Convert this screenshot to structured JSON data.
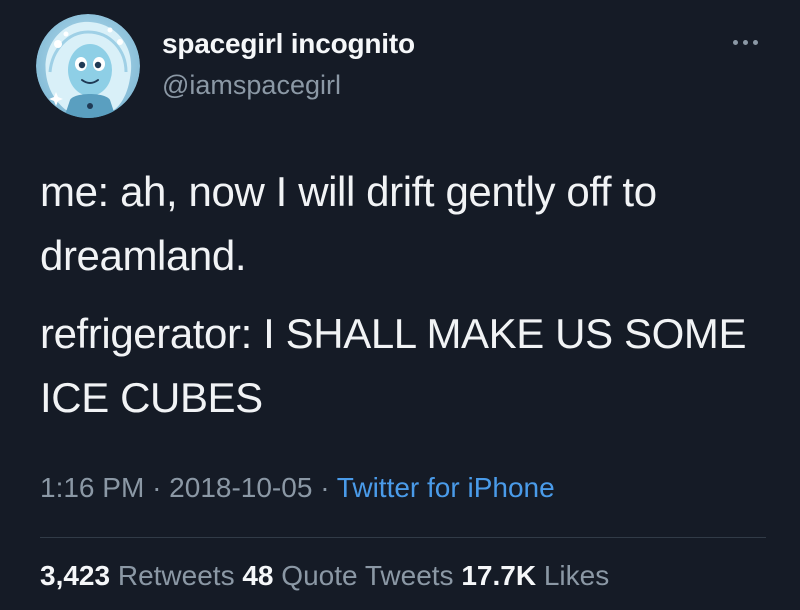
{
  "author": {
    "name": "spacegirl incognito",
    "handle": "@iamspacegirl",
    "avatar_icon": "cartoon-space-girl-avatar"
  },
  "more_icon": "ellipsis-icon",
  "tweet": {
    "lines": [
      "me: ah, now I will drift gently off to",
      "dreamland.",
      "refrigerator: I SHALL MAKE US SOME",
      "ICE CUBES"
    ]
  },
  "meta": {
    "time": "1:16 PM",
    "separator": "·",
    "date": "2018-10-05",
    "source": "Twitter for iPhone"
  },
  "stats": {
    "retweets": {
      "count": "3,423",
      "label": "Retweets"
    },
    "quotes": {
      "count": "48",
      "label": "Quote Tweets"
    },
    "likes": {
      "count": "17.7K",
      "label": "Likes"
    }
  },
  "colors": {
    "background": "#151b26",
    "primary_text": "#f1f3f5",
    "secondary_text": "#8b98a5",
    "link": "#4a9be9",
    "divider": "#313b47"
  }
}
